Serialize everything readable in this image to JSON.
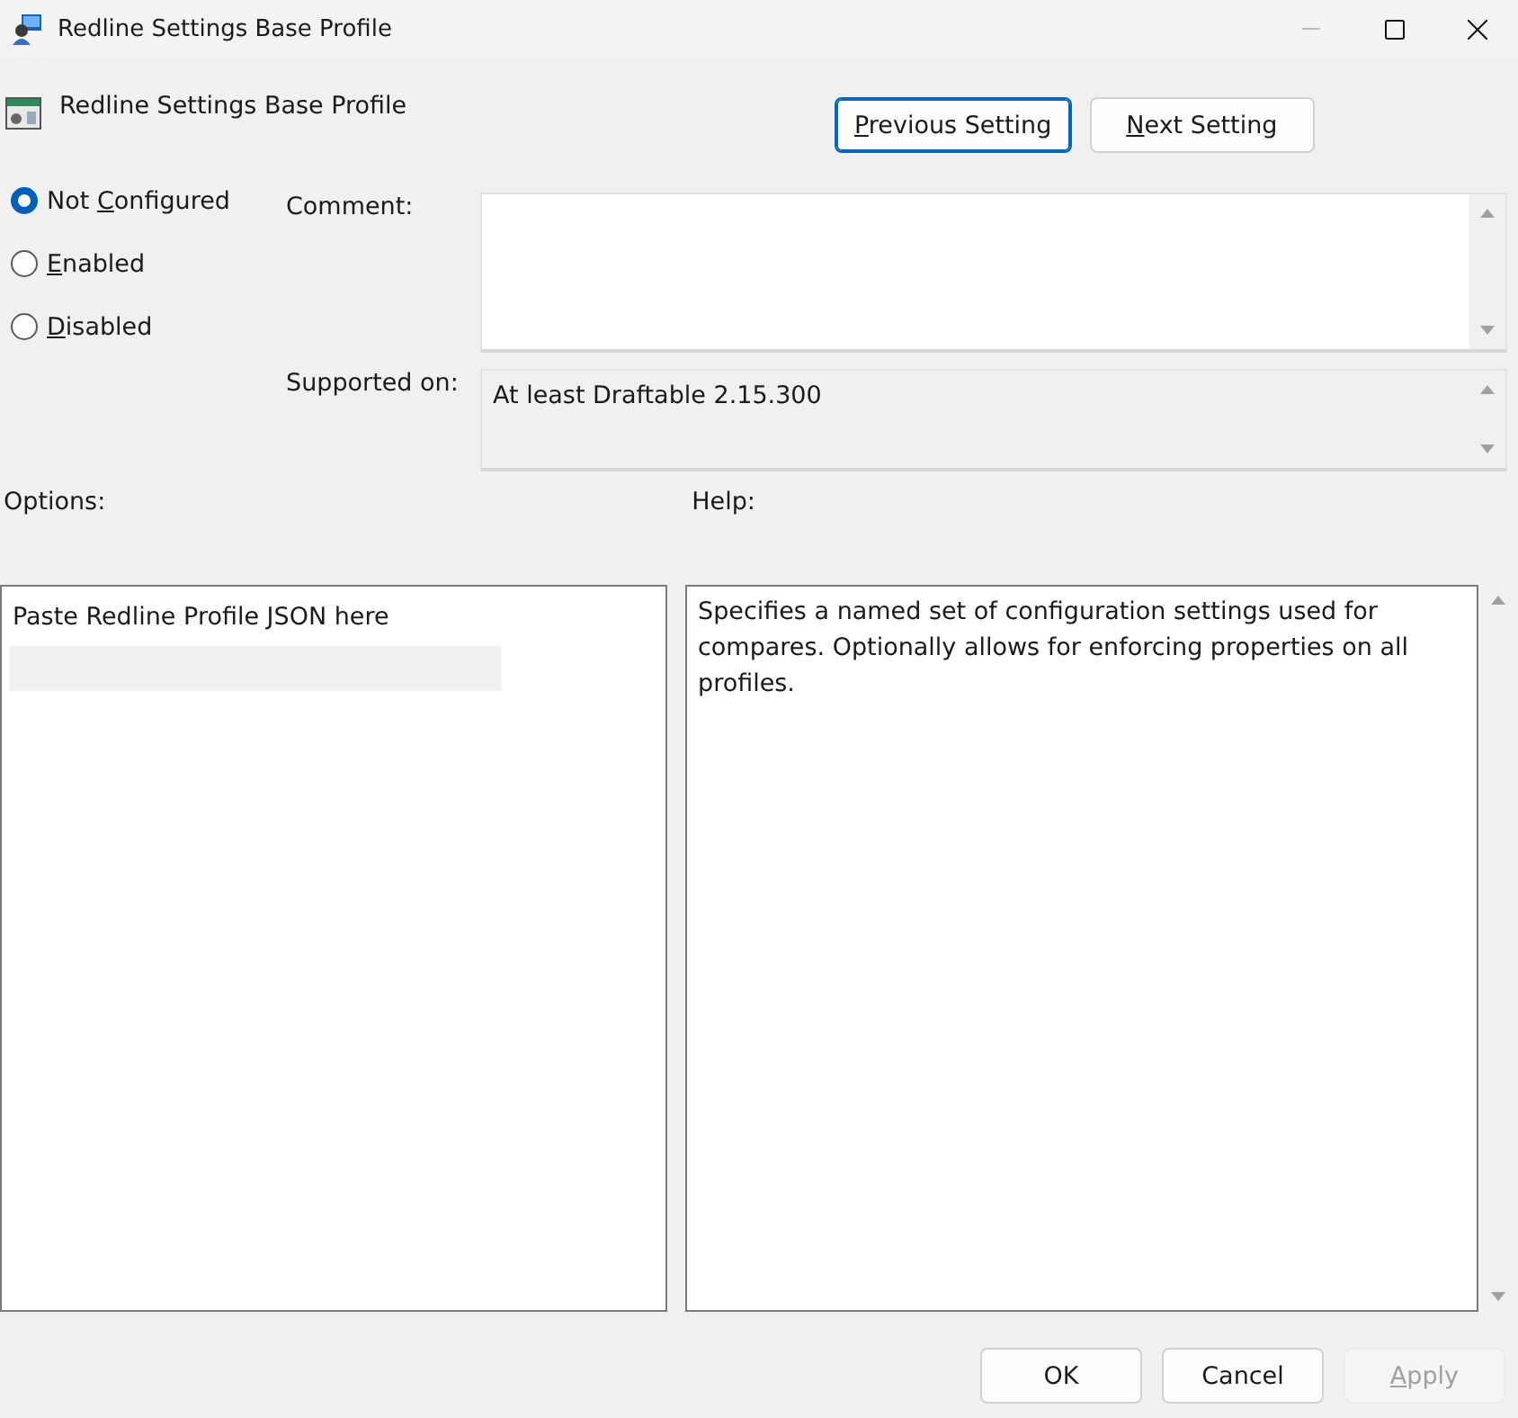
{
  "window": {
    "title": "Redline Settings Base Profile"
  },
  "setting_title": "Redline Settings Base Profile",
  "nav_buttons": [
    {
      "key": "P",
      "suffix": "revious Setting",
      "focused": true
    },
    {
      "key": "N",
      "suffix": "ext Setting",
      "focused": false
    }
  ],
  "state_options": [
    {
      "prefix": "Not ",
      "key": "C",
      "suffix": "onfigured",
      "selected": true
    },
    {
      "key": "E",
      "suffix": "nabled",
      "selected": false
    },
    {
      "key": "D",
      "suffix": "isabled",
      "selected": false
    }
  ],
  "comment": {
    "label": "Comment:"
  },
  "supported_on": {
    "label": "Supported on:",
    "value": "At least Draftable 2.15.300"
  },
  "options": {
    "label": "Options:",
    "prompt": "Paste Redline Profile JSON here"
  },
  "help": {
    "label": "Help:",
    "text": "Specifies a named set of configuration settings used for compares. Optionally allows for enforcing properties on all profiles."
  },
  "dialog_buttons": [
    {
      "suffix": "OK",
      "disabled": false
    },
    {
      "suffix": "Cancel",
      "disabled": false
    },
    {
      "key": "A",
      "suffix": "pply",
      "disabled": true
    }
  ]
}
